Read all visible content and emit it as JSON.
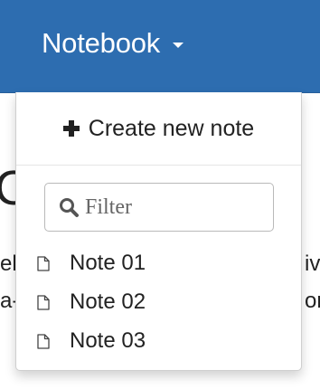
{
  "navbar": {
    "brand_label": "Notebook",
    "bg_color": "#2d6db0"
  },
  "background": {
    "heading_fragment": "C",
    "line1_left": "eb",
    "line1_right": "iv",
    "line2_left": "a-",
    "line2_right": "or"
  },
  "dropdown": {
    "create_label": "Create new note",
    "filter_placeholder": "Filter",
    "notes": [
      {
        "label": "Note 01"
      },
      {
        "label": "Note 02"
      },
      {
        "label": "Note 03"
      }
    ]
  }
}
